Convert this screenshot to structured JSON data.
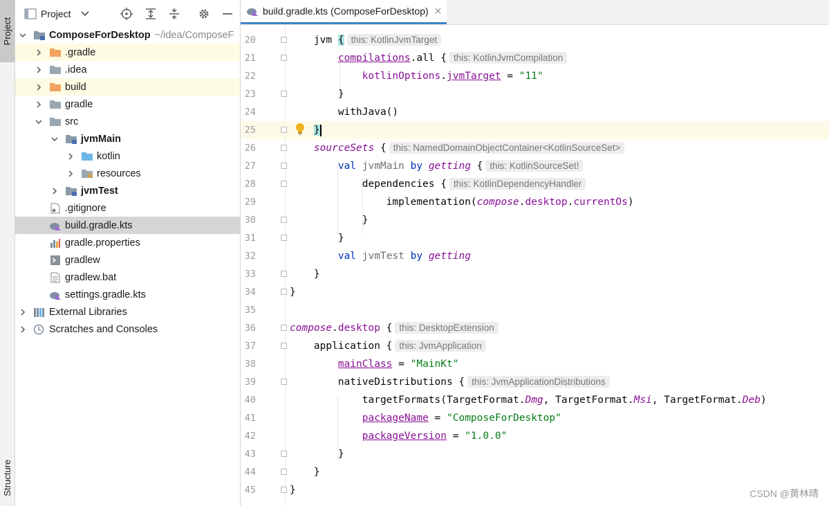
{
  "sidebar_tabs": {
    "project": "Project",
    "structure": "Structure"
  },
  "panel": {
    "title": "Project",
    "tree": [
      {
        "label": "ComposeForDesktop",
        "suffix": "~/idea/ComposeF",
        "bold": true
      },
      {
        "label": ".gradle"
      },
      {
        "label": ".idea"
      },
      {
        "label": "build"
      },
      {
        "label": "gradle"
      },
      {
        "label": "src"
      },
      {
        "label": "jvmMain",
        "bold": true
      },
      {
        "label": "kotlin"
      },
      {
        "label": "resources"
      },
      {
        "label": "jvmTest",
        "bold": true
      },
      {
        "label": ".gitignore"
      },
      {
        "label": "build.gradle.kts"
      },
      {
        "label": "gradle.properties"
      },
      {
        "label": "gradlew"
      },
      {
        "label": "gradlew.bat"
      },
      {
        "label": "settings.gradle.kts"
      },
      {
        "label": "External Libraries"
      },
      {
        "label": "Scratches and Consoles"
      }
    ]
  },
  "editor": {
    "tab_label": "build.gradle.kts (ComposeForDesktop)",
    "lines": [
      {
        "n": "20"
      },
      {
        "n": "21"
      },
      {
        "n": "22"
      },
      {
        "n": "23"
      },
      {
        "n": "24"
      },
      {
        "n": "25"
      },
      {
        "n": "26"
      },
      {
        "n": "27"
      },
      {
        "n": "28"
      },
      {
        "n": "29"
      },
      {
        "n": "30"
      },
      {
        "n": "31"
      },
      {
        "n": "32"
      },
      {
        "n": "33"
      },
      {
        "n": "34"
      },
      {
        "n": "35"
      },
      {
        "n": "36"
      },
      {
        "n": "37"
      },
      {
        "n": "38"
      },
      {
        "n": "39"
      },
      {
        "n": "40"
      },
      {
        "n": "41"
      },
      {
        "n": "42"
      },
      {
        "n": "43"
      },
      {
        "n": "44"
      },
      {
        "n": "45"
      }
    ],
    "hints": {
      "h20": "this: KotlinJvmTarget",
      "h21": "this: KotlinJvmCompilation",
      "h26": "this: NamedDomainObjectContainer<KotlinSourceSet>",
      "h27": "this: KotlinSourceSet!",
      "h28": "this: KotlinDependencyHandler",
      "h36": "this: DesktopExtension",
      "h37": "this: JvmApplication",
      "h39": "this: JvmApplicationDistributions"
    },
    "strings": {
      "s22": "\"11\"",
      "s38": "\"MainKt\"",
      "s41": "\"ComposeForDesktop\"",
      "s42": "\"1.0.0\""
    }
  },
  "watermark": "CSDN @黄林晴",
  "colors": {
    "keyword": "#0033b3",
    "property": "#871094",
    "string": "#067d17",
    "accent": "#4083c9"
  }
}
